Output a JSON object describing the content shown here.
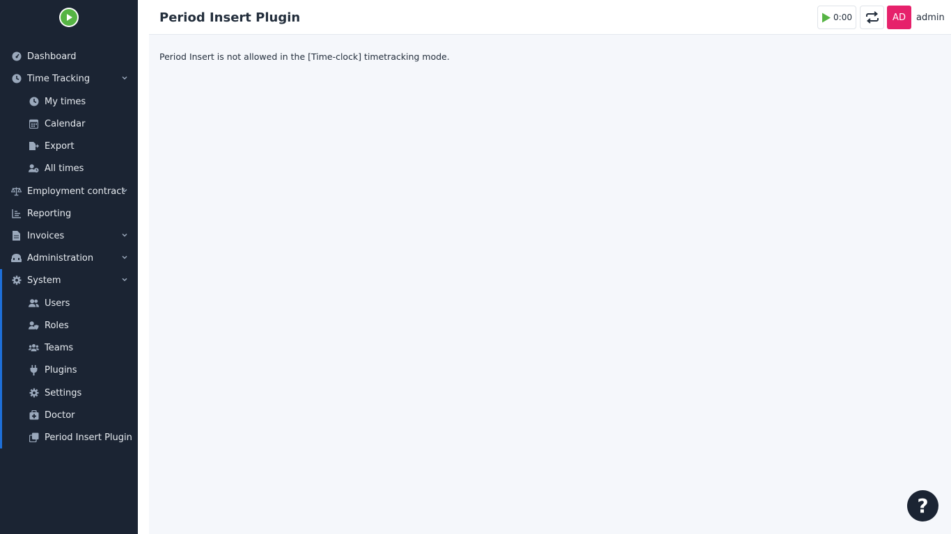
{
  "header": {
    "title": "Period Insert Plugin",
    "timer": "0:00",
    "avatar_initials": "AD",
    "username": "admin"
  },
  "sidebar": {
    "items": [
      {
        "label": "Dashboard",
        "icon": "dashboard-icon"
      },
      {
        "label": "Time Tracking",
        "icon": "clock-icon"
      },
      {
        "label": "My times",
        "icon": "clock-icon"
      },
      {
        "label": "Calendar",
        "icon": "calendar-icon"
      },
      {
        "label": "Export",
        "icon": "export-icon"
      },
      {
        "label": "All times",
        "icon": "user-clock-icon"
      },
      {
        "label": "Employment contract",
        "icon": "scale-icon"
      },
      {
        "label": "Reporting",
        "icon": "chart-icon"
      },
      {
        "label": "Invoices",
        "icon": "file-invoice-icon"
      },
      {
        "label": "Administration",
        "icon": "toolbox-icon"
      },
      {
        "label": "System",
        "icon": "gear-icon"
      },
      {
        "label": "Users",
        "icon": "users-icon"
      },
      {
        "label": "Roles",
        "icon": "user-shield-icon"
      },
      {
        "label": "Teams",
        "icon": "team-icon"
      },
      {
        "label": "Plugins",
        "icon": "plug-icon"
      },
      {
        "label": "Settings",
        "icon": "gear-icon"
      },
      {
        "label": "Doctor",
        "icon": "medkit-icon"
      },
      {
        "label": "Period Insert Plugin",
        "icon": "copy-icon"
      }
    ]
  },
  "main": {
    "message": "Period Insert is not allowed in the [Time-clock] timetracking mode."
  },
  "help": {
    "symbol": "?"
  },
  "colors": {
    "sidebar_bg": "#1b2433",
    "accent": "#1e6fd9",
    "avatar_bg": "#e6216b",
    "logo_green": "#56b444"
  }
}
